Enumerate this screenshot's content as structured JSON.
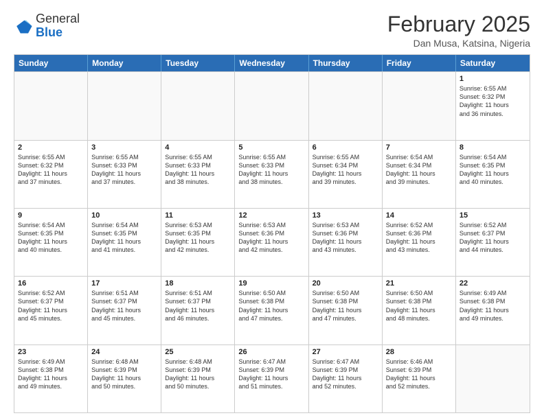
{
  "logo": {
    "general": "General",
    "blue": "Blue"
  },
  "header": {
    "month": "February 2025",
    "location": "Dan Musa, Katsina, Nigeria"
  },
  "days_of_week": [
    "Sunday",
    "Monday",
    "Tuesday",
    "Wednesday",
    "Thursday",
    "Friday",
    "Saturday"
  ],
  "weeks": [
    [
      {
        "day": "",
        "info": ""
      },
      {
        "day": "",
        "info": ""
      },
      {
        "day": "",
        "info": ""
      },
      {
        "day": "",
        "info": ""
      },
      {
        "day": "",
        "info": ""
      },
      {
        "day": "",
        "info": ""
      },
      {
        "day": "1",
        "info": "Sunrise: 6:55 AM\nSunset: 6:32 PM\nDaylight: 11 hours\nand 36 minutes."
      }
    ],
    [
      {
        "day": "2",
        "info": "Sunrise: 6:55 AM\nSunset: 6:32 PM\nDaylight: 11 hours\nand 37 minutes."
      },
      {
        "day": "3",
        "info": "Sunrise: 6:55 AM\nSunset: 6:33 PM\nDaylight: 11 hours\nand 37 minutes."
      },
      {
        "day": "4",
        "info": "Sunrise: 6:55 AM\nSunset: 6:33 PM\nDaylight: 11 hours\nand 38 minutes."
      },
      {
        "day": "5",
        "info": "Sunrise: 6:55 AM\nSunset: 6:33 PM\nDaylight: 11 hours\nand 38 minutes."
      },
      {
        "day": "6",
        "info": "Sunrise: 6:55 AM\nSunset: 6:34 PM\nDaylight: 11 hours\nand 39 minutes."
      },
      {
        "day": "7",
        "info": "Sunrise: 6:54 AM\nSunset: 6:34 PM\nDaylight: 11 hours\nand 39 minutes."
      },
      {
        "day": "8",
        "info": "Sunrise: 6:54 AM\nSunset: 6:35 PM\nDaylight: 11 hours\nand 40 minutes."
      }
    ],
    [
      {
        "day": "9",
        "info": "Sunrise: 6:54 AM\nSunset: 6:35 PM\nDaylight: 11 hours\nand 40 minutes."
      },
      {
        "day": "10",
        "info": "Sunrise: 6:54 AM\nSunset: 6:35 PM\nDaylight: 11 hours\nand 41 minutes."
      },
      {
        "day": "11",
        "info": "Sunrise: 6:53 AM\nSunset: 6:35 PM\nDaylight: 11 hours\nand 42 minutes."
      },
      {
        "day": "12",
        "info": "Sunrise: 6:53 AM\nSunset: 6:36 PM\nDaylight: 11 hours\nand 42 minutes."
      },
      {
        "day": "13",
        "info": "Sunrise: 6:53 AM\nSunset: 6:36 PM\nDaylight: 11 hours\nand 43 minutes."
      },
      {
        "day": "14",
        "info": "Sunrise: 6:52 AM\nSunset: 6:36 PM\nDaylight: 11 hours\nand 43 minutes."
      },
      {
        "day": "15",
        "info": "Sunrise: 6:52 AM\nSunset: 6:37 PM\nDaylight: 11 hours\nand 44 minutes."
      }
    ],
    [
      {
        "day": "16",
        "info": "Sunrise: 6:52 AM\nSunset: 6:37 PM\nDaylight: 11 hours\nand 45 minutes."
      },
      {
        "day": "17",
        "info": "Sunrise: 6:51 AM\nSunset: 6:37 PM\nDaylight: 11 hours\nand 45 minutes."
      },
      {
        "day": "18",
        "info": "Sunrise: 6:51 AM\nSunset: 6:37 PM\nDaylight: 11 hours\nand 46 minutes."
      },
      {
        "day": "19",
        "info": "Sunrise: 6:50 AM\nSunset: 6:38 PM\nDaylight: 11 hours\nand 47 minutes."
      },
      {
        "day": "20",
        "info": "Sunrise: 6:50 AM\nSunset: 6:38 PM\nDaylight: 11 hours\nand 47 minutes."
      },
      {
        "day": "21",
        "info": "Sunrise: 6:50 AM\nSunset: 6:38 PM\nDaylight: 11 hours\nand 48 minutes."
      },
      {
        "day": "22",
        "info": "Sunrise: 6:49 AM\nSunset: 6:38 PM\nDaylight: 11 hours\nand 49 minutes."
      }
    ],
    [
      {
        "day": "23",
        "info": "Sunrise: 6:49 AM\nSunset: 6:38 PM\nDaylight: 11 hours\nand 49 minutes."
      },
      {
        "day": "24",
        "info": "Sunrise: 6:48 AM\nSunset: 6:39 PM\nDaylight: 11 hours\nand 50 minutes."
      },
      {
        "day": "25",
        "info": "Sunrise: 6:48 AM\nSunset: 6:39 PM\nDaylight: 11 hours\nand 50 minutes."
      },
      {
        "day": "26",
        "info": "Sunrise: 6:47 AM\nSunset: 6:39 PM\nDaylight: 11 hours\nand 51 minutes."
      },
      {
        "day": "27",
        "info": "Sunrise: 6:47 AM\nSunset: 6:39 PM\nDaylight: 11 hours\nand 52 minutes."
      },
      {
        "day": "28",
        "info": "Sunrise: 6:46 AM\nSunset: 6:39 PM\nDaylight: 11 hours\nand 52 minutes."
      },
      {
        "day": "",
        "info": ""
      }
    ]
  ]
}
